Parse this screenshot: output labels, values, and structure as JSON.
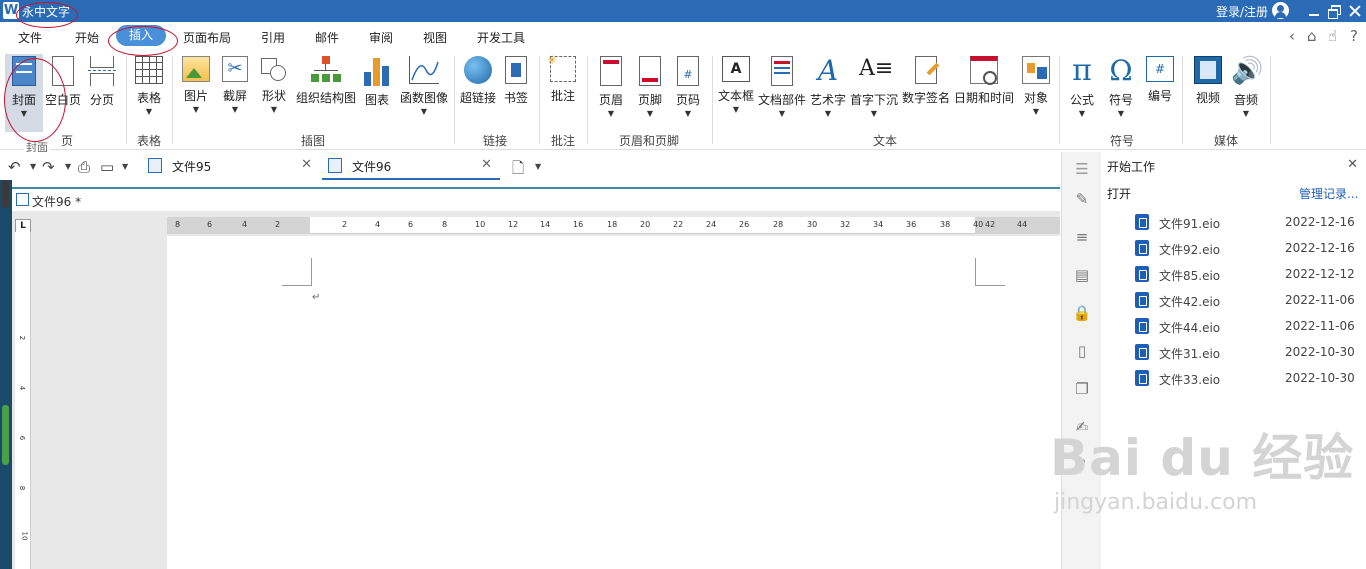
{
  "app": {
    "title": "永中文字",
    "logo_letter": "W",
    "login": "登录/注册"
  },
  "menu": {
    "tabs": [
      {
        "label": "文件"
      },
      {
        "label": "开始"
      },
      {
        "label": "插入",
        "active": true
      },
      {
        "label": "页面布局"
      },
      {
        "label": "引用"
      },
      {
        "label": "邮件"
      },
      {
        "label": "审阅"
      },
      {
        "label": "视图"
      },
      {
        "label": "开发工具"
      }
    ],
    "nav_icons": [
      "‹",
      "⌂",
      "☝",
      "?"
    ]
  },
  "ribbon": {
    "groups": [
      {
        "label": "页"
      },
      {
        "label": "表格"
      },
      {
        "label": "插图"
      },
      {
        "label": "链接"
      },
      {
        "label": "批注"
      },
      {
        "label": "页眉和页脚"
      },
      {
        "label": "文本"
      },
      {
        "label": "符号"
      },
      {
        "label": "媒体"
      }
    ],
    "buttons": [
      {
        "label": "封面",
        "icon": "cover-icon",
        "dropdown": true,
        "selected": true
      },
      {
        "label": "空白页",
        "icon": "blank-page-icon"
      },
      {
        "label": "分页",
        "icon": "page-break-icon"
      },
      {
        "label": "表格",
        "icon": "table-icon",
        "dropdown": true
      },
      {
        "label": "图片",
        "icon": "picture-icon",
        "dropdown": true
      },
      {
        "label": "截屏",
        "icon": "screenshot-icon",
        "dropdown": true
      },
      {
        "label": "形状",
        "icon": "shape-icon",
        "dropdown": true
      },
      {
        "label": "组织结构图",
        "icon": "org-chart-icon"
      },
      {
        "label": "图表",
        "icon": "chart-icon"
      },
      {
        "label": "函数图像",
        "icon": "function-graph-icon",
        "dropdown": true
      },
      {
        "label": "超链接",
        "icon": "hyperlink-icon"
      },
      {
        "label": "书签",
        "icon": "bookmark-icon"
      },
      {
        "label": "批注",
        "icon": "comment-icon"
      },
      {
        "label": "页眉",
        "icon": "header-icon",
        "dropdown": true
      },
      {
        "label": "页脚",
        "icon": "footer-icon",
        "dropdown": true
      },
      {
        "label": "页码",
        "icon": "page-number-icon",
        "dropdown": true
      },
      {
        "label": "文本框",
        "icon": "textbox-icon",
        "dropdown": true
      },
      {
        "label": "文档部件",
        "icon": "doc-part-icon",
        "dropdown": true
      },
      {
        "label": "艺术字",
        "icon": "wordart-icon",
        "dropdown": true
      },
      {
        "label": "首字下沉",
        "icon": "drop-cap-icon",
        "dropdown": true
      },
      {
        "label": "数字签名",
        "icon": "digital-signature-icon"
      },
      {
        "label": "日期和时间",
        "icon": "date-time-icon"
      },
      {
        "label": "对象",
        "icon": "object-icon",
        "dropdown": true
      },
      {
        "label": "公式",
        "icon": "formula-icon",
        "dropdown": true
      },
      {
        "label": "符号",
        "icon": "symbol-icon",
        "dropdown": true
      },
      {
        "label": "编号",
        "icon": "numbering-icon"
      },
      {
        "label": "视频",
        "icon": "video-icon"
      },
      {
        "label": "音频",
        "icon": "audio-icon",
        "dropdown": true
      }
    ],
    "tooltip": "封面"
  },
  "doc_tabs": [
    {
      "label": "文件95"
    },
    {
      "label": "文件96",
      "active": true
    }
  ],
  "doc_path": "文件96 *",
  "ruler": {
    "h_ticks": [
      "8",
      "6",
      "4",
      "2",
      "2",
      "4",
      "6",
      "8",
      "10",
      "12",
      "14",
      "16",
      "18",
      "20",
      "22",
      "24",
      "26",
      "28",
      "30",
      "32",
      "34",
      "36",
      "38",
      "40",
      "42",
      "44"
    ],
    "v_ticks": [
      "2",
      "4",
      "6",
      "8",
      "10"
    ]
  },
  "panel": {
    "title": "开始工作",
    "open_label": "打开",
    "manage_label": "管理记录...",
    "files": [
      {
        "name": "文件91.eio",
        "date": "2022-12-16"
      },
      {
        "name": "文件92.eio",
        "date": "2022-12-16"
      },
      {
        "name": "文件85.eio",
        "date": "2022-12-12"
      },
      {
        "name": "文件42.eio",
        "date": "2022-11-06"
      },
      {
        "name": "文件44.eio",
        "date": "2022-11-06"
      },
      {
        "name": "文件31.eio",
        "date": "2022-10-30"
      },
      {
        "name": "文件33.eio",
        "date": "2022-10-30"
      }
    ]
  },
  "watermark": {
    "line1": "Bai du 经验",
    "line2": "jingyan.baidu.com"
  },
  "colors": {
    "title_bar": "#2b6bb6",
    "active_tab": "#4a90d9",
    "annotation": "#c8102e",
    "link": "#1e5fb3"
  }
}
